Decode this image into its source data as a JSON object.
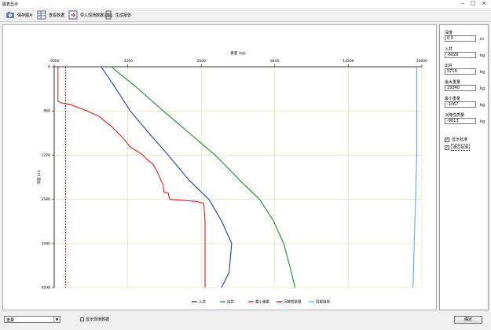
{
  "window": {
    "title": "图表显示",
    "controls": [
      "–",
      "□",
      "×"
    ]
  },
  "toolbar": {
    "buttons": [
      {
        "label": "保存图片",
        "icon": "save-icon"
      },
      {
        "label": "查看数据",
        "icon": "table-icon"
      },
      {
        "label": "导入现场数据",
        "icon": "import-icon"
      },
      {
        "label": "生成报告",
        "icon": "printer-icon"
      }
    ]
  },
  "side_panel": {
    "fields": [
      {
        "label": "深度",
        "value": "0.0",
        "unit": "m"
      },
      {
        "label": "入井",
        "value": "-6026",
        "unit": "kg"
      },
      {
        "label": "出井",
        "value": "5719",
        "unit": "kg"
      },
      {
        "label": "最大重量",
        "value": "19340",
        "unit": "kg"
      },
      {
        "label": "最小重量",
        "value": "-1067",
        "unit": "kg"
      },
      {
        "label": "沉降性质量",
        "value": "-9013",
        "unit": "kg"
      }
    ],
    "checkboxes": [
      {
        "label": "显示标准",
        "checked": true,
        "mark": "✓"
      },
      {
        "label": "通过标准",
        "checked": true,
        "mark": "✓"
      }
    ]
  },
  "bottom": {
    "dropdown_value": "重量",
    "dropdown_arrow": "▼",
    "show_field_label": "显示现场数据",
    "ok_label": "确定"
  },
  "colors": {
    "in_well": "#1f3f9f",
    "out_well": "#1f8a2a",
    "min_weight": "#e02020",
    "buckling": "#cc1010",
    "yield_limit": "#5aaee6",
    "grid": "#d8e0a8"
  },
  "chart_data": {
    "type": "line",
    "title": "",
    "xlabel": "重量 (kg)",
    "ylabel": "深度 (m)",
    "x_ticks": [
      -9000,
      -3200,
      2600,
      8400,
      14200,
      20000
    ],
    "y_ticks": [
      0,
      860,
      1720,
      2580,
      3440,
      4298
    ],
    "xlim": [
      -9000,
      20000
    ],
    "ylim": [
      0,
      4298
    ],
    "y_inverted": true,
    "grid": true,
    "legend_position": "bottom",
    "series": [
      {
        "name": "入井",
        "color_key": "in_well",
        "style": "solid",
        "points": [
          [
            -5300,
            0
          ],
          [
            -4200,
            400
          ],
          [
            -3000,
            860
          ],
          [
            -1500,
            1300
          ],
          [
            0,
            1720
          ],
          [
            1600,
            2200
          ],
          [
            3200,
            2580
          ],
          [
            4200,
            3000
          ],
          [
            5000,
            3440
          ],
          [
            4800,
            4000
          ],
          [
            4200,
            4298
          ]
        ]
      },
      {
        "name": "出井",
        "color_key": "out_well",
        "style": "solid",
        "points": [
          [
            -4500,
            0
          ],
          [
            -2500,
            400
          ],
          [
            -400,
            860
          ],
          [
            1700,
            1300
          ],
          [
            3700,
            1720
          ],
          [
            5600,
            2200
          ],
          [
            7200,
            2580
          ],
          [
            8300,
            3000
          ],
          [
            9100,
            3440
          ],
          [
            9600,
            3900
          ],
          [
            10000,
            4298
          ]
        ]
      },
      {
        "name": "最小重量",
        "color_key": "min_weight",
        "style": "solid",
        "points": [
          [
            -8700,
            0
          ],
          [
            -8700,
            670
          ],
          [
            -8500,
            700
          ],
          [
            -7800,
            730
          ],
          [
            -6800,
            820
          ],
          [
            -5500,
            960
          ],
          [
            -4400,
            1180
          ],
          [
            -3600,
            1380
          ],
          [
            -3000,
            1560
          ],
          [
            -2100,
            1700
          ],
          [
            -1700,
            1800
          ],
          [
            -1200,
            1900
          ],
          [
            -900,
            2030
          ],
          [
            -600,
            2200
          ],
          [
            -400,
            2300
          ],
          [
            -350,
            2440
          ],
          [
            0,
            2460
          ],
          [
            100,
            2580
          ],
          [
            2200,
            2620
          ],
          [
            2800,
            2660
          ],
          [
            2900,
            3000
          ],
          [
            2900,
            3440
          ],
          [
            2900,
            4298
          ]
        ]
      },
      {
        "name": "沉降性质量",
        "color_key": "buckling",
        "style": "dashed",
        "points": [
          [
            -8100,
            0
          ],
          [
            -8100,
            4298
          ]
        ]
      },
      {
        "name": "屈服极限",
        "color_key": "yield_limit",
        "style": "solid",
        "points": [
          [
            19600,
            0
          ],
          [
            19600,
            1720
          ],
          [
            19500,
            2580
          ],
          [
            19400,
            3440
          ],
          [
            19300,
            4298
          ]
        ]
      }
    ]
  }
}
